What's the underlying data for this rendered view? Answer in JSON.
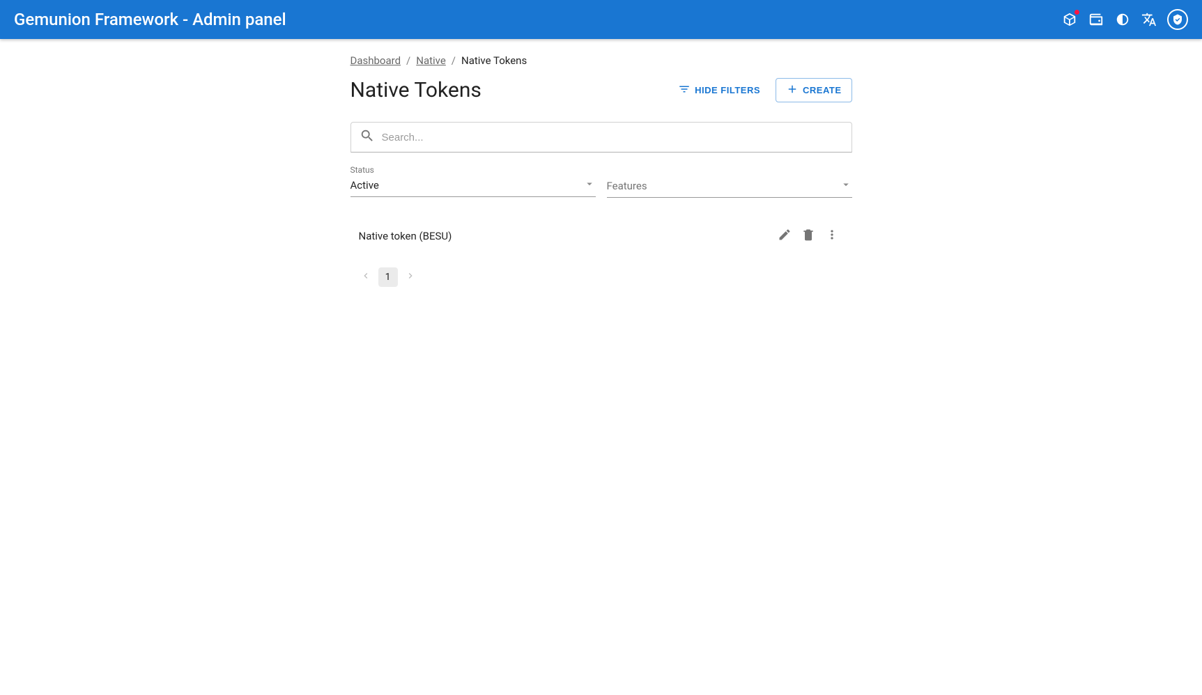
{
  "header": {
    "title": "Gemunion Framework - Admin panel"
  },
  "breadcrumb": {
    "items": [
      {
        "label": "Dashboard",
        "link": true
      },
      {
        "label": "Native",
        "link": true
      },
      {
        "label": "Native Tokens",
        "link": false
      }
    ],
    "sep": "/"
  },
  "page": {
    "title": "Native Tokens"
  },
  "actions": {
    "hide_filters": "HIDE FILTERS",
    "create": "CREATE"
  },
  "search": {
    "placeholder": "Search..."
  },
  "filters": {
    "status": {
      "label": "Status",
      "value": "Active"
    },
    "features": {
      "label": "Features",
      "value": ""
    }
  },
  "list": {
    "items": [
      {
        "name": "Native token (BESU)"
      }
    ]
  },
  "pagination": {
    "pages": [
      "1"
    ],
    "current": "1"
  }
}
